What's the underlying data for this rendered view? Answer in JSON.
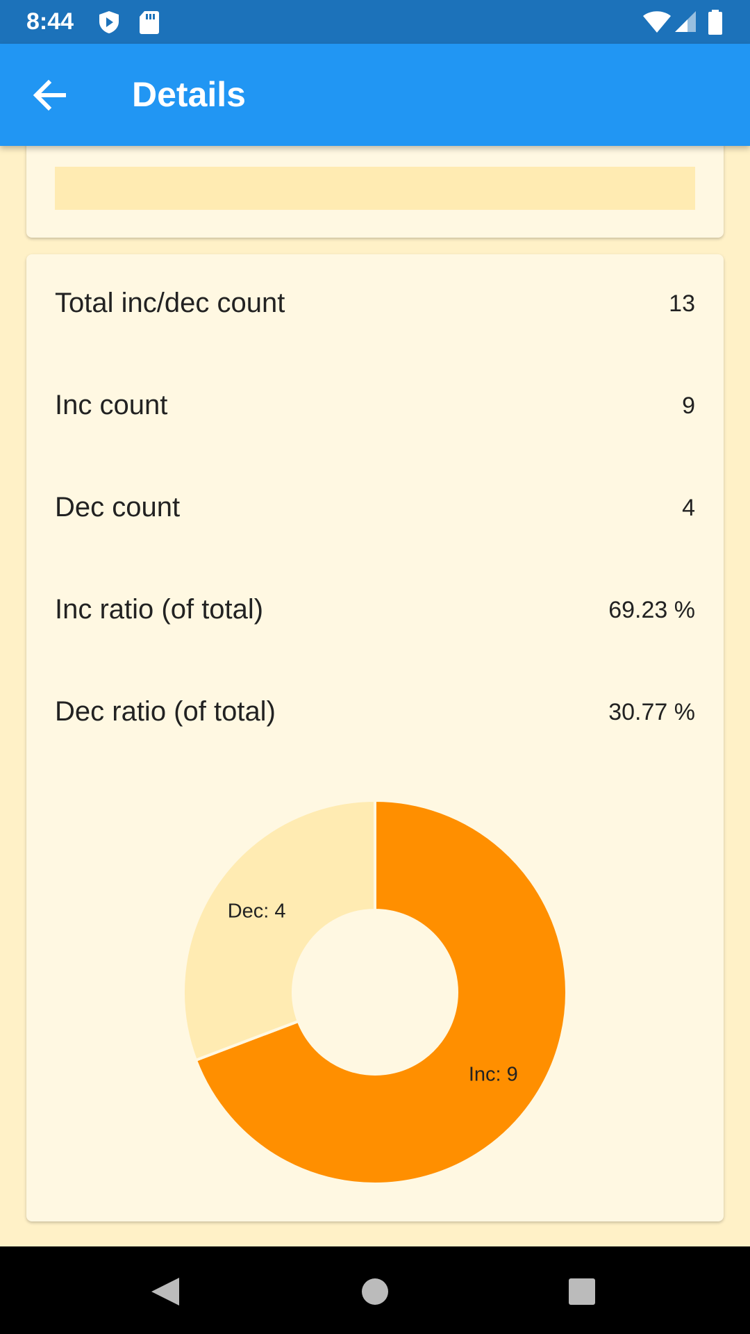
{
  "status_bar": {
    "time": "8:44"
  },
  "app_bar": {
    "title": "Details",
    "back_icon": "arrow-left-icon"
  },
  "stats": [
    {
      "label": "Total inc/dec count",
      "value": "13"
    },
    {
      "label": "Inc count",
      "value": "9"
    },
    {
      "label": "Dec count",
      "value": "4"
    },
    {
      "label": "Inc ratio (of total)",
      "value": "69.23 %"
    },
    {
      "label": "Dec ratio (of total)",
      "value": "30.77 %"
    }
  ],
  "colors": {
    "inc": "#FF8F00",
    "dec": "#FFEBB2",
    "app_bar": "#2196F3",
    "status_bar": "#1C72BA",
    "card": "#FFF8E2",
    "background": "#FFF1C7"
  },
  "chart_data": {
    "type": "pie",
    "donut": true,
    "slices": [
      {
        "label": "Inc: 9",
        "value": 9
      },
      {
        "label": "Dec: 4",
        "value": 4
      }
    ]
  }
}
